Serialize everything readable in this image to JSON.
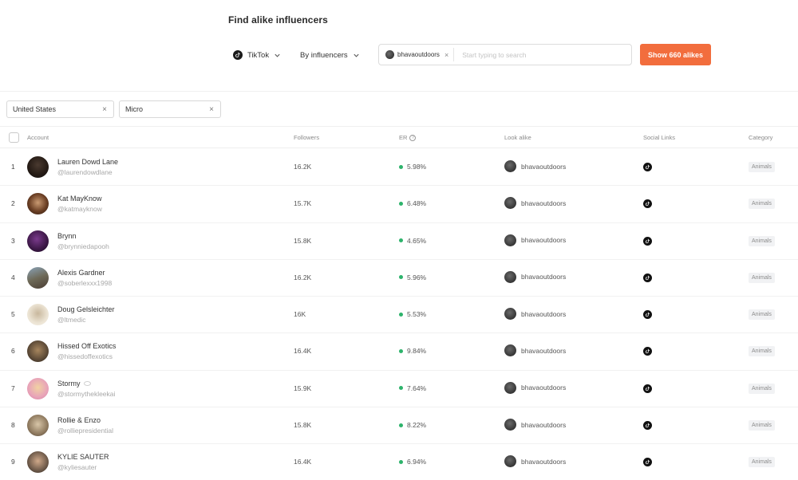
{
  "page": {
    "title": "Find alike influencers"
  },
  "toolbar": {
    "platform": "TikTok",
    "mode": "By influencers",
    "search": {
      "chip_label": "bhavaoutdoors",
      "placeholder": "Start typing to search"
    },
    "cta_label": "Show 660 alikes"
  },
  "filters": [
    {
      "label": "United States"
    },
    {
      "label": "Micro"
    }
  ],
  "table": {
    "columns": {
      "account": "Account",
      "followers": "Followers",
      "er": "ER",
      "lookalike": "Look alike",
      "social": "Social Links",
      "category": "Category"
    },
    "rows": [
      {
        "rank": "1",
        "name": "Lauren Dowd Lane",
        "handle": "@laurendowdlane",
        "followers": "16.2K",
        "er": "5.98%",
        "lookalike": "bhavaoutdoors",
        "category": "Animals"
      },
      {
        "rank": "2",
        "name": "Kat MayKnow",
        "handle": "@katmayknow",
        "followers": "15.7K",
        "er": "6.48%",
        "lookalike": "bhavaoutdoors",
        "category": "Animals"
      },
      {
        "rank": "3",
        "name": "Brynn",
        "handle": "@brynniedapooh",
        "followers": "15.8K",
        "er": "4.65%",
        "lookalike": "bhavaoutdoors",
        "category": "Animals"
      },
      {
        "rank": "4",
        "name": "Alexis Gardner",
        "handle": "@soberlexxx1998",
        "followers": "16.2K",
        "er": "5.96%",
        "lookalike": "bhavaoutdoors",
        "category": "Animals"
      },
      {
        "rank": "5",
        "name": "Doug Gelsleichter",
        "handle": "@ltmedic",
        "followers": "16K",
        "er": "5.53%",
        "lookalike": "bhavaoutdoors",
        "category": "Animals"
      },
      {
        "rank": "6",
        "name": "Hissed Off Exotics",
        "handle": "@hissedoffexotics",
        "followers": "16.4K",
        "er": "9.84%",
        "lookalike": "bhavaoutdoors",
        "category": "Animals"
      },
      {
        "rank": "7",
        "name": "Stormy",
        "handle": "@stormythekleekai",
        "followers": "15.9K",
        "er": "7.64%",
        "lookalike": "bhavaoutdoors",
        "category": "Animals"
      },
      {
        "rank": "8",
        "name": "Rollie & Enzo",
        "handle": "@rolliepresidential",
        "followers": "15.8K",
        "er": "8.22%",
        "lookalike": "bhavaoutdoors",
        "category": "Animals"
      },
      {
        "rank": "9",
        "name": "KYLIE SAUTER",
        "handle": "@kyliesauter",
        "followers": "16.4K",
        "er": "6.94%",
        "lookalike": "bhavaoutdoors",
        "category": "Animals"
      }
    ]
  },
  "colors": {
    "accent": "#f26d3d",
    "er_dot": "#2db36b"
  },
  "icons": {
    "platform": "tiktok-icon",
    "social": "tiktok-icon",
    "dropdown": "chevron-down-icon",
    "remove": "close-icon",
    "er_info": "question-circle-icon"
  }
}
